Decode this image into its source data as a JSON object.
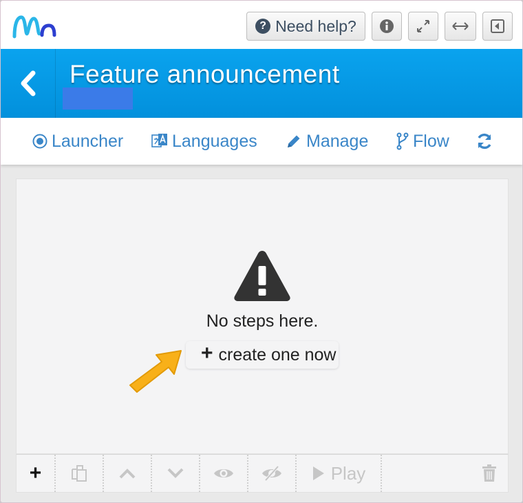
{
  "topbar": {
    "logo_icon": "mn-logo-icon",
    "help_label": "Need help?",
    "help_icon": "question-circle-icon",
    "info_icon": "info-circle-icon",
    "expand_icon": "expand-icon",
    "width_icon": "arrows-horizontal-icon",
    "collapse_icon": "collapse-panel-icon"
  },
  "header": {
    "back_icon": "chevron-left-icon",
    "title": "Feature announcement"
  },
  "nav": {
    "items": [
      {
        "label": "Launcher",
        "icon": "target-icon"
      },
      {
        "label": "Languages",
        "icon": "translate-icon"
      },
      {
        "label": "Manage",
        "icon": "pencil-icon"
      },
      {
        "label": "Flow",
        "icon": "branch-icon"
      }
    ],
    "refresh_icon": "refresh-icon"
  },
  "empty_state": {
    "icon": "warning-triangle-icon",
    "message": "No steps here.",
    "create_label": "create one now",
    "create_icon": "plus-icon"
  },
  "toolbar": {
    "play_label": "Play",
    "icons": [
      "plus-icon",
      "copy-icon",
      "chevron-up-icon",
      "chevron-down-icon",
      "eye-icon",
      "eye-slash-icon",
      "play-icon",
      "trash-icon"
    ]
  },
  "colors": {
    "header_blue": "#0a9be6",
    "link_blue": "#3a86c8",
    "highlight_blue": "#3b7be8",
    "arrow_yellow": "#f8b019"
  }
}
